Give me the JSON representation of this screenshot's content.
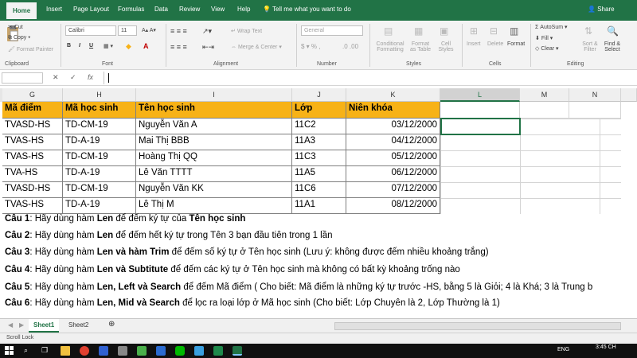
{
  "tabs": [
    "Home",
    "Insert",
    "Page Layout",
    "Formulas",
    "Data",
    "Review",
    "View",
    "Help"
  ],
  "tell_me": "Tell me what you want to do",
  "share": "Share",
  "ribbon": {
    "clipboard": {
      "cut": "Cut",
      "copy": "Copy",
      "format_painter": "Format Painter",
      "label": "Clipboard"
    },
    "font": {
      "name": "Calibri",
      "size": "11",
      "bold": "B",
      "italic": "I",
      "underline": "U",
      "label": "Font"
    },
    "alignment": {
      "wrap": "Wrap Text",
      "merge": "Merge & Center",
      "label": "Alignment"
    },
    "number": {
      "format": "General",
      "label": "Number"
    },
    "styles": {
      "conditional": "Conditional Formatting",
      "format_as": "Format as Table",
      "cell": "Cell Styles",
      "label": "Styles"
    },
    "cells": {
      "insert": "Insert",
      "delete": "Delete",
      "format": "Format",
      "label": "Cells"
    },
    "editing": {
      "autosum": "AutoSum",
      "fill": "Fill",
      "clear": "Clear",
      "sort": "Sort & Filter",
      "find": "Find & Select",
      "label": "Editing"
    }
  },
  "formula_bar": {
    "fx": "fx",
    "value": ""
  },
  "columns": [
    "G",
    "H",
    "I",
    "J",
    "K",
    "L",
    "M",
    "N"
  ],
  "table": {
    "headers": [
      "Mã điểm",
      "Mã học sinh",
      "Tên học sinh",
      "Lớp",
      "Niên khóa"
    ],
    "rows": [
      [
        "TVASD-HS",
        "TD-CM-19",
        "Nguyễn Văn A",
        "11C2",
        "03/12/2000"
      ],
      [
        "TVAS-HS",
        "TD-A-19",
        "Mai Thị BBB",
        "11A3",
        "04/12/2000"
      ],
      [
        "TVAS-HS",
        "TD-CM-19",
        "Hoàng Thị QQ",
        "11C3",
        "05/12/2000"
      ],
      [
        "TVA-HS",
        "TD-A-19",
        "Lê Văn TTTT",
        "11A5",
        "06/12/2000"
      ],
      [
        "TVASD-HS",
        "TD-CM-19",
        "Nguyễn Văn KK",
        "11C6",
        "07/12/2000"
      ],
      [
        "TVAS-HS",
        "TD-A-19",
        "Lê Thị M",
        "11A1",
        "08/12/2000"
      ]
    ]
  },
  "questions": [
    {
      "label": "Câu 1",
      "parts": [
        [
          "n",
          ": Hãy dùng hàm "
        ],
        [
          "b",
          "Len"
        ],
        [
          "n",
          " để đếm ký tự của "
        ],
        [
          "b",
          "Tên học sinh"
        ]
      ]
    },
    {
      "label": "Câu 2",
      "parts": [
        [
          "n",
          ": Hãy dùng hàm "
        ],
        [
          "b",
          "Len"
        ],
        [
          "n",
          " để đếm hết ký tự trong Tên 3 bạn đầu tiên  trong 1 lần"
        ]
      ]
    },
    {
      "label": "Câu 3",
      "parts": [
        [
          "n",
          ": Hãy dùng hàm "
        ],
        [
          "b",
          "Len và hàm Trim"
        ],
        [
          "n",
          " để đếm số ký tự ở Tên học sinh (Lưu ý: không được đếm nhiều khoảng trắng)"
        ]
      ]
    },
    {
      "label": "Câu 4",
      "parts": [
        [
          "n",
          ": Hãy dùng hàm "
        ],
        [
          "b",
          "Len và Subtitute"
        ],
        [
          "n",
          " để đếm các ký tự ở Tên học sinh mà không có bất kỳ khoảng trống nào"
        ]
      ]
    },
    {
      "label": "Câu 5",
      "parts": [
        [
          "n",
          ": Hãy dùng hàm "
        ],
        [
          "b",
          "Len, Left và Search"
        ],
        [
          "n",
          " để đếm Mã điểm ( Cho biết: Mã điểm là những ký tự trước -HS, bằng 5 là Giỏi; 4 là Khá; 3 là Trung b"
        ]
      ]
    },
    {
      "label": "Câu 6",
      "parts": [
        [
          "n",
          ": Hãy dùng hàm "
        ],
        [
          "b",
          "Len, Mid và Search"
        ],
        [
          "n",
          " để lọc ra loại lớp ở Mã học sinh (Cho biết: Lớp Chuyên là 2, Lớp Thường là 1)"
        ]
      ]
    }
  ],
  "sheets": [
    "Sheet1",
    "Sheet2"
  ],
  "status": "Scroll Lock",
  "taskbar": {
    "lang": "ENG",
    "time": "3:45 CH"
  }
}
